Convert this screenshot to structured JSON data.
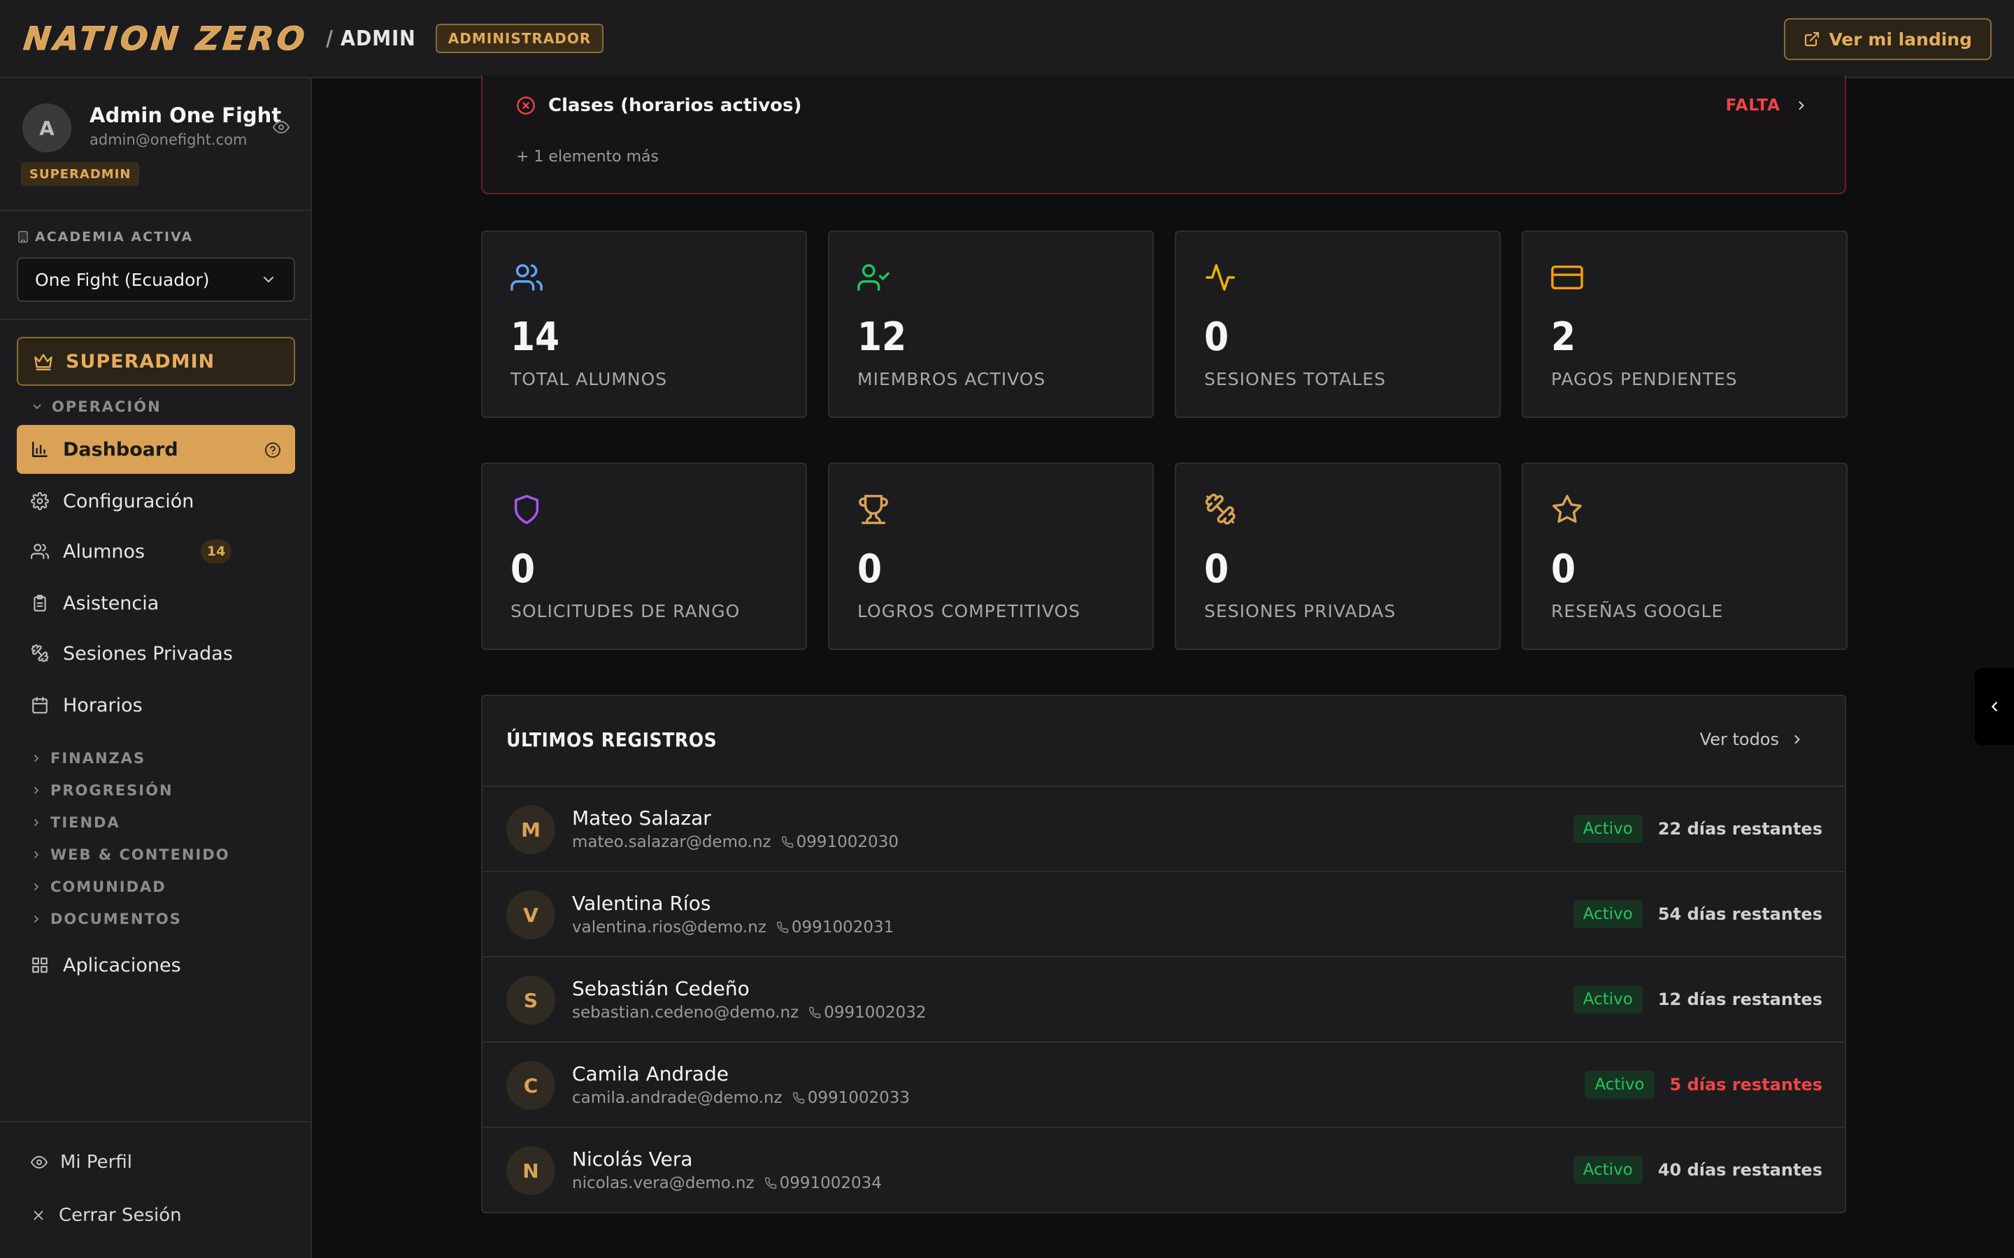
{
  "header": {
    "brand": "NATION ZERO",
    "section": "ADMIN",
    "role_badge": "ADMINISTRADOR",
    "landing_button": "Ver mi landing"
  },
  "sidebar": {
    "user": {
      "initial": "A",
      "name": "Admin One Fight",
      "email": "admin@onefight.com",
      "badge": "SUPERADMIN"
    },
    "academy_label": "ACADEMIA ACTIVA",
    "academy_selected": "One Fight (Ecuador)",
    "superadmin_label": "SUPERADMIN",
    "operation_group": "OPERACIÓN",
    "items": [
      {
        "label": "Dashboard"
      },
      {
        "label": "Configuración"
      },
      {
        "label": "Alumnos",
        "count": "14"
      },
      {
        "label": "Asistencia"
      },
      {
        "label": "Sesiones Privadas"
      },
      {
        "label": "Horarios"
      }
    ],
    "groups": [
      "FINANZAS",
      "PROGRESIÓN",
      "TIENDA",
      "WEB & CONTENIDO",
      "COMUNIDAD",
      "DOCUMENTOS"
    ],
    "apps": "Aplicaciones",
    "profile_link": "Mi Perfil",
    "logout_link": "Cerrar Sesión"
  },
  "alert": {
    "item": "Clases (horarios activos)",
    "status": "FALTA",
    "more": "+ 1 elemento más"
  },
  "stats": [
    {
      "value": "14",
      "label": "TOTAL ALUMNOS",
      "color": "#60a5fa"
    },
    {
      "value": "12",
      "label": "MIEMBROS ACTIVOS",
      "color": "#22c55e"
    },
    {
      "value": "0",
      "label": "SESIONES TOTALES",
      "color": "#eab308"
    },
    {
      "value": "2",
      "label": "PAGOS PENDIENTES",
      "color": "#f59e0b"
    },
    {
      "value": "0",
      "label": "SOLICITUDES DE RANGO",
      "color": "#a855f7"
    },
    {
      "value": "0",
      "label": "LOGROS COMPETITIVOS",
      "color": "#d9a256"
    },
    {
      "value": "0",
      "label": "SESIONES PRIVADAS",
      "color": "#d9a256"
    },
    {
      "value": "0",
      "label": "RESEÑAS GOOGLE",
      "color": "#d9a256"
    }
  ],
  "registros": {
    "title": "ÚLTIMOS REGISTROS",
    "view_all": "Ver todos",
    "rows": [
      {
        "initial": "M",
        "name": "Mateo Salazar",
        "email": "mateo.salazar@demo.nz",
        "phone": "0991002030",
        "status": "Activo",
        "days": "22 días restantes"
      },
      {
        "initial": "V",
        "name": "Valentina Ríos",
        "email": "valentina.rios@demo.nz",
        "phone": "0991002031",
        "status": "Activo",
        "days": "54 días restantes"
      },
      {
        "initial": "S",
        "name": "Sebastián Cedeño",
        "email": "sebastian.cedeno@demo.nz",
        "phone": "0991002032",
        "status": "Activo",
        "days": "12 días restantes"
      },
      {
        "initial": "C",
        "name": "Camila Andrade",
        "email": "camila.andrade@demo.nz",
        "phone": "0991002033",
        "status": "Activo",
        "days": "5 días restantes"
      },
      {
        "initial": "N",
        "name": "Nicolás Vera",
        "email": "nicolas.vera@demo.nz",
        "phone": "0991002034",
        "status": "Activo",
        "days": "40 días restantes"
      }
    ]
  },
  "colors": {
    "accent": "#d9a256",
    "danger": "#ef4444",
    "success": "#22c55e"
  }
}
